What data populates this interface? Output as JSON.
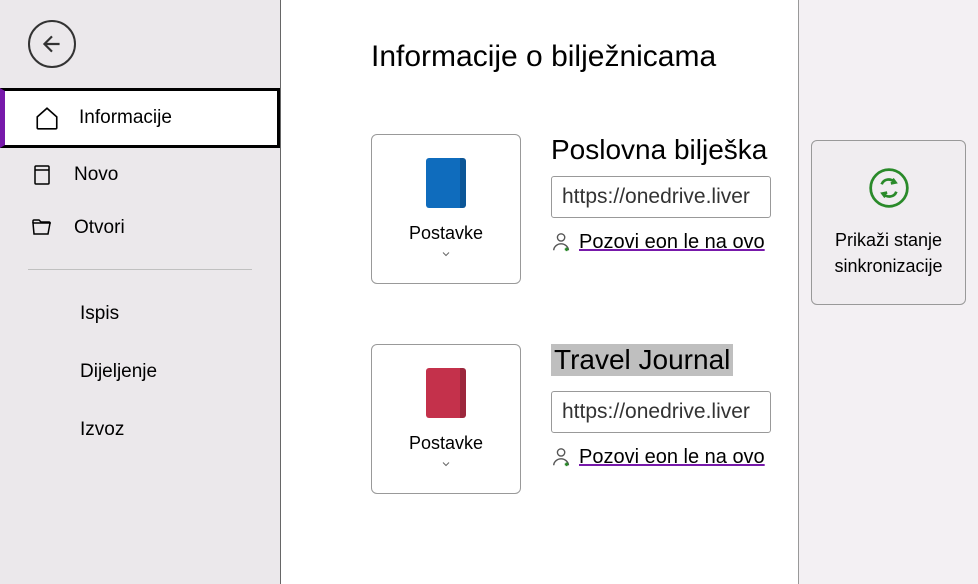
{
  "sidebar": {
    "items": [
      {
        "label": "Informacije"
      },
      {
        "label": "Novo"
      },
      {
        "label": "Otvori"
      }
    ],
    "subitems": [
      {
        "label": "Ispis"
      },
      {
        "label": "Dijeljenje"
      },
      {
        "label": "Izvoz"
      }
    ]
  },
  "main": {
    "title": "Informacije o bilježnicama",
    "notebooks": [
      {
        "color": "#0f6cbd",
        "settings_label": "Postavke",
        "name": "Poslovna bilješka",
        "url": "https://onedrive.liver",
        "invite": "Pozovi eon le na ovo"
      },
      {
        "color": "#c4314b",
        "settings_label": "Postavke",
        "name": "Travel Journal",
        "url": "https://onedrive.liver",
        "invite": "Pozovi eon le na ovo"
      }
    ]
  },
  "sync": {
    "label_line1": "Prikaži stanje",
    "label_line2": "sinkronizacije"
  }
}
